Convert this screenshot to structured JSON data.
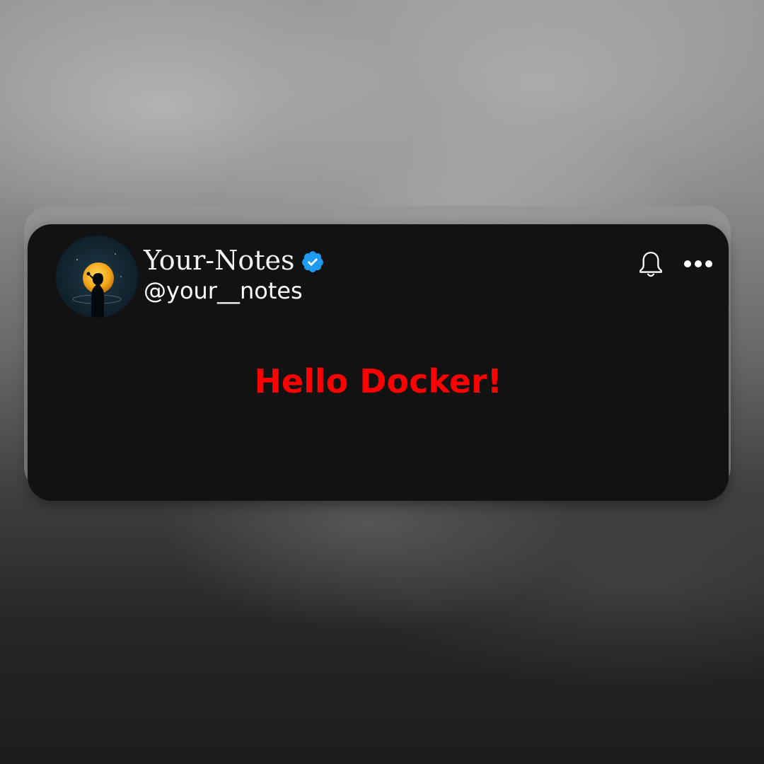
{
  "post": {
    "author": {
      "display_name": "Your-Notes",
      "handle": "@your__notes",
      "verified": true,
      "avatar_icon": "moon-silhouette-avatar"
    },
    "text": "Hello Docker!",
    "text_color": "#ff0000"
  },
  "actions": {
    "notify_icon": "bell-icon",
    "more_icon": "more-horizontal-icon"
  },
  "colors": {
    "card_background": "#121212",
    "verified_badge": "#1d9bf0",
    "name_text": "#f2f2f2"
  }
}
